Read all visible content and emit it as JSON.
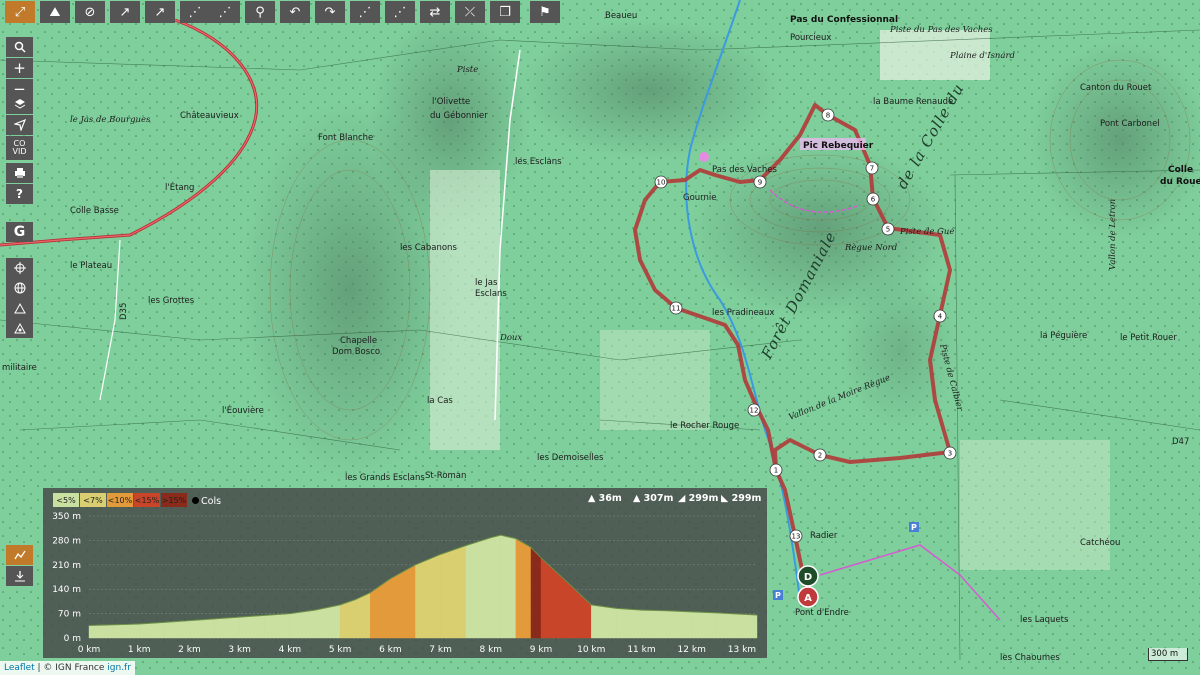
{
  "toolbar": {
    "top_buttons": [
      "fullscreen-icon",
      "route-up-icon",
      "eye-off-icon",
      "arrow-ne-icon",
      "arrow-ne-icon",
      "route-icon",
      "route-icon",
      "bike-icon",
      "undo-icon",
      "redo-icon",
      "route-icon",
      "route-icon",
      "swap-icon",
      "no-route-icon",
      "copy-icon",
      "pin-icon"
    ],
    "left_buttons": {
      "co_vid_line1": "CO",
      "co_vid_line2": "VID",
      "help": "?",
      "google": "G"
    }
  },
  "map_labels": {
    "pas_confessionnal": "Pas du Confessionnal",
    "piste_pas_vaches": "Piste du Pas des Vaches",
    "plaine_isnard": "Plaine d'Isnard",
    "beaueu": "Beaueu",
    "pourcieux": "Pourcieux",
    "canton_rouet": "Canton du Rouet",
    "pont_carbonel": "Pont Carbonel",
    "colle_du_rouet_1": "Colle",
    "colle_du_rouet_2": "du Rouet",
    "la_baume_renaude": "la Baume Renaude",
    "pic_rebequier": "Pic Rebequier",
    "gournie": "Gournie",
    "pas_vaches": "Pas des Vaches",
    "olivette": "l'Olivette",
    "dy_gebonnier": "du Gébonnier",
    "les_esclans": "les Esclans",
    "font_blanche": "Font Blanche",
    "chateauvieux": "Châteauvieux",
    "jas_bourgues": "le Jas de Bourgues",
    "letang": "l'Étang",
    "colle_basse": "Colle Basse",
    "les_cabanons": "les Cabanons",
    "le_plateau": "le Plateau",
    "les_grottes": "les Grottes",
    "le_jas_esclans_1": "le Jas",
    "le_jas_esclans_2": "Esclans",
    "chapelle_1": "Chapelle",
    "chapelle_2": "Dom Bosco",
    "leouviere": "l'Éouvière",
    "la_cas": "la Cas",
    "les_grands_esclans": "les Grands Esclans",
    "st_roman": "St-Roman",
    "les_demoiselles": "les Demoiselles",
    "le_rocher_rouge": "le Rocher Rouge",
    "les_pradineaux": "les Pradineaux",
    "piste_gue": "Piste de Gué",
    "regue_nord": "Règue Nord",
    "la_peguiere": "la Péguière",
    "le_petit_rouer": "le Petit Rouer",
    "vallon_letron": "Vallon de Letron",
    "catcheou": "Catchéou",
    "les_laquets": "les Laquets",
    "les_chaoumes": "les Chaoumes",
    "pont_endre": "Pont d'Endre",
    "radier": "Radier",
    "d47": "D47",
    "vallon_moire_regue": "Vallon de la Moire Règue",
    "foret_domaniale": "Forêt Domaniale",
    "de_la_colle": "de la Colle du",
    "piste_label": "Piste",
    "doux": "Doux",
    "piste_calbier": "Piste de Calbier",
    "militaire": "militaire",
    "d35": "D35"
  },
  "waypoints": [
    "1",
    "2",
    "3",
    "4",
    "5",
    "6",
    "7",
    "8",
    "9",
    "10",
    "11",
    "12",
    "13"
  ],
  "start_marker": "A",
  "end_marker": "D",
  "profile": {
    "legend": [
      "<5%",
      "<7%",
      "<10%",
      "<15%",
      ">15%"
    ],
    "legend_colors": [
      "#c9e0a0",
      "#d9cf70",
      "#e39a3a",
      "#c9452a",
      "#8a2a1a"
    ],
    "cols_label": "Cols",
    "stats": [
      "36m",
      "307m",
      "299m",
      "299m"
    ],
    "y_ticks": [
      "350 m",
      "280 m",
      "210 m",
      "140 m",
      "70 m",
      "0 m"
    ],
    "x_ticks": [
      "0 km",
      "1 km",
      "2 km",
      "3 km",
      "4 km",
      "5 km",
      "6 km",
      "7 km",
      "8 km",
      "9 km",
      "10 km",
      "11 km",
      "12 km",
      "13 km"
    ],
    "chart_data": {
      "type": "area",
      "xlabel": "",
      "ylabel": "",
      "ylim": [
        0,
        350
      ],
      "xlim": [
        0,
        13.3
      ],
      "x": [
        0,
        0.5,
        1,
        1.5,
        2,
        2.5,
        3,
        3.5,
        4,
        4.5,
        5,
        5.3,
        5.6,
        6,
        6.5,
        7,
        7.5,
        8,
        8.2,
        8.5,
        8.8,
        9,
        9.3,
        9.6,
        10,
        10.5,
        11,
        11.5,
        12,
        12.5,
        13,
        13.3
      ],
      "y": [
        36,
        38,
        40,
        45,
        50,
        55,
        60,
        65,
        70,
        80,
        95,
        110,
        130,
        170,
        210,
        240,
        265,
        288,
        295,
        285,
        260,
        230,
        190,
        150,
        95,
        85,
        80,
        78,
        75,
        72,
        68,
        66
      ]
    }
  },
  "attribution": {
    "leaflet": "Leaflet",
    "sep": " | © IGN France ",
    "ign": "ign.fr"
  },
  "scale": "300 m"
}
